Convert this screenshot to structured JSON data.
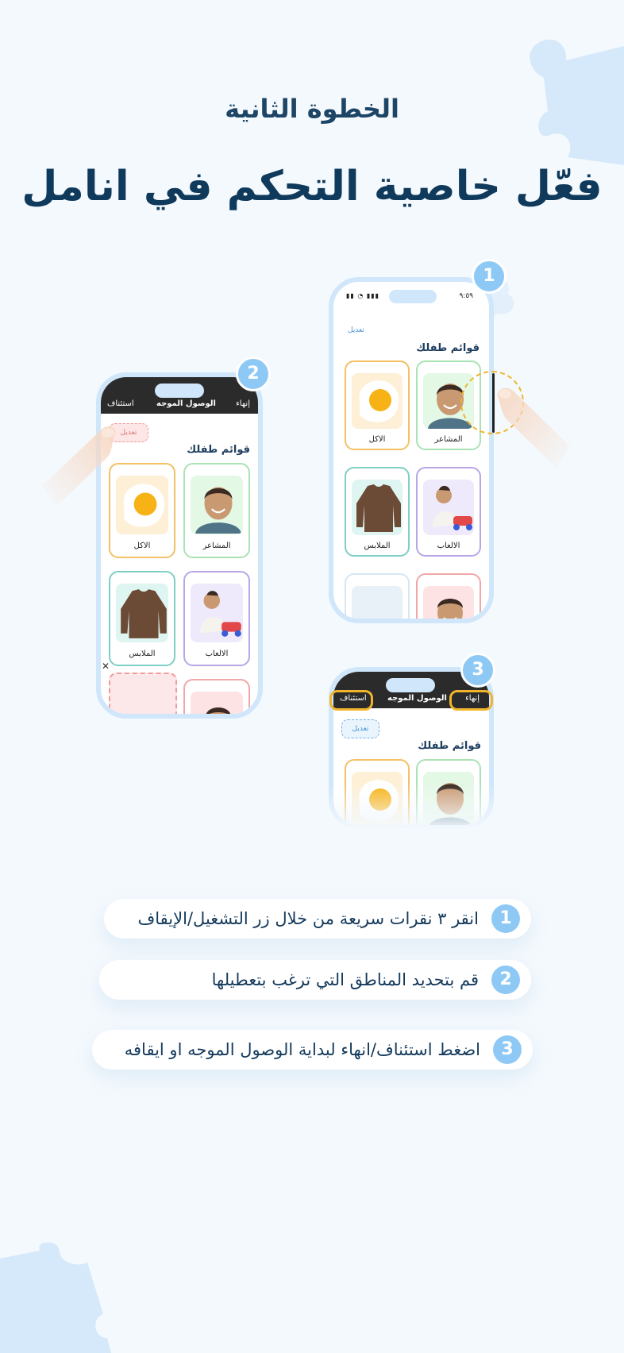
{
  "step_label": "الخطوة الثانية",
  "headline": "فعّل خاصية التحكم في انامل",
  "colors": {
    "background": "#f4f9fd",
    "accent": "#8ec9f6",
    "heading": "#0f3a5c",
    "highlight": "#f1b52c"
  },
  "phone1": {
    "badge": "1",
    "status_time": "٩:٥٩",
    "edit": "تعديل",
    "list_title": "قوائم طفلك",
    "cards": [
      {
        "label": "المشاعر",
        "icon": "boy-portrait-icon"
      },
      {
        "label": "الاكل",
        "icon": "fried-egg-icon"
      },
      {
        "label": "الالعاب",
        "icon": "child-playing-icon"
      },
      {
        "label": "الملابس",
        "icon": "sweater-icon"
      }
    ]
  },
  "phone2": {
    "badge": "2",
    "finish": "إنهاء",
    "guided_access": "الوصول الموجه",
    "resume": "استئناف",
    "edit": "تعديل",
    "list_title": "قوائم طفلك",
    "close_mark": "✕",
    "cards": [
      {
        "label": "المشاعر",
        "icon": "boy-portrait-icon"
      },
      {
        "label": "الاكل",
        "icon": "fried-egg-icon"
      },
      {
        "label": "الالعاب",
        "icon": "child-playing-icon"
      },
      {
        "label": "الملابس",
        "icon": "sweater-icon"
      }
    ]
  },
  "phone3": {
    "badge": "3",
    "finish": "إنهاء",
    "guided_access": "الوصول الموجه",
    "resume": "استئناف",
    "edit": "تعديل",
    "list_title": "قوائم طفلك"
  },
  "instructions": [
    {
      "num": "1",
      "text": "انقر ٣ نقرات سريعة من خلال زر التشغيل/الإيقاف"
    },
    {
      "num": "2",
      "text": "قم بتحديد المناطق التي ترغب بتعطيلها"
    },
    {
      "num": "3",
      "text": "اضغط استئناف/انهاء لبداية الوصول الموجه او ايقافه"
    }
  ]
}
